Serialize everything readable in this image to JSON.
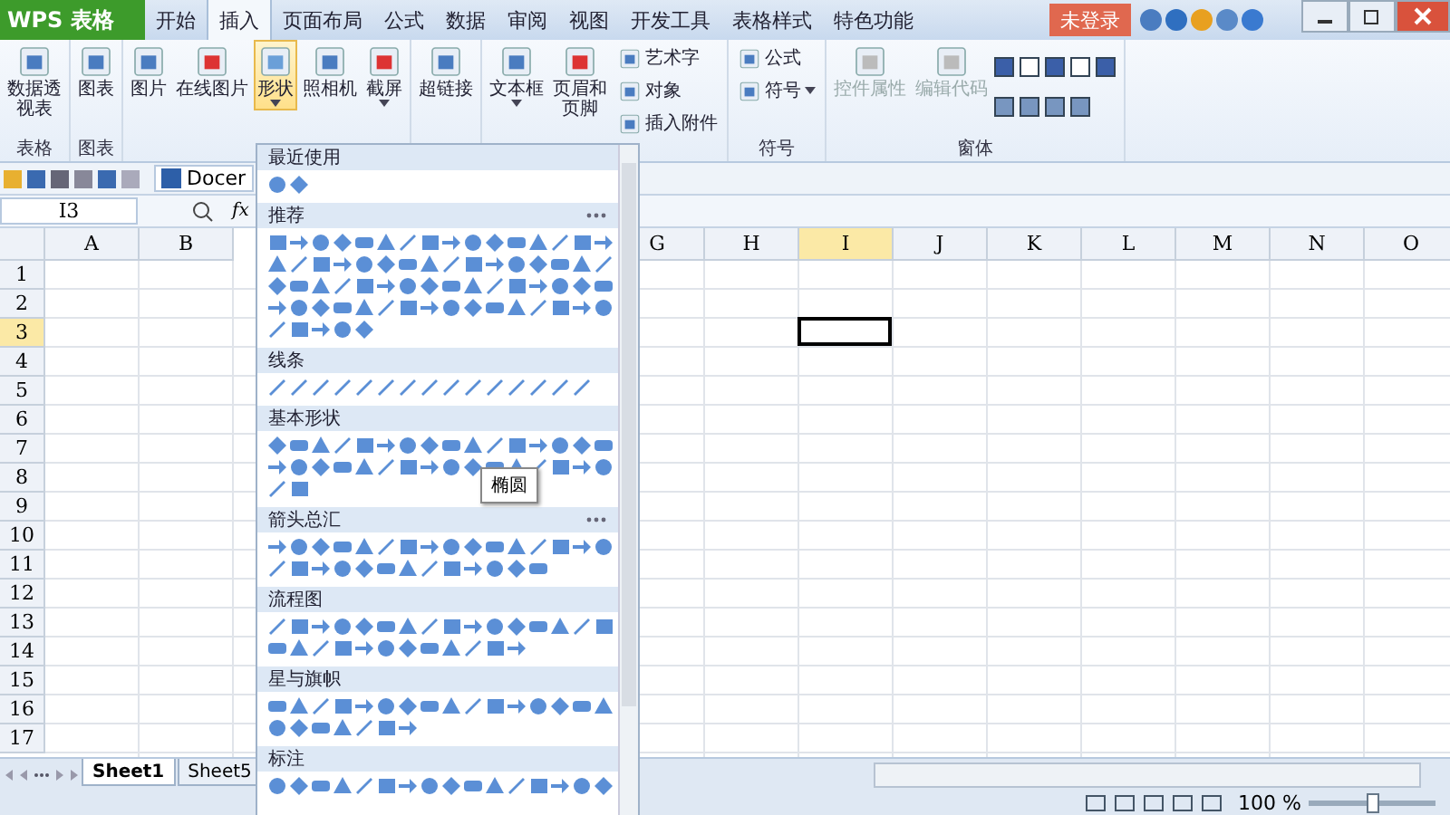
{
  "app_button": {
    "label": "WPS 表格"
  },
  "menu_tabs": [
    {
      "label": "开始",
      "selected": false
    },
    {
      "label": "插入",
      "selected": true
    },
    {
      "label": "页面布局",
      "selected": false
    },
    {
      "label": "公式",
      "selected": false
    },
    {
      "label": "数据",
      "selected": false
    },
    {
      "label": "审阅",
      "selected": false
    },
    {
      "label": "视图",
      "selected": false
    },
    {
      "label": "开发工具",
      "selected": false
    },
    {
      "label": "表格样式",
      "selected": false
    },
    {
      "label": "特色功能",
      "selected": false
    }
  ],
  "login": {
    "label": "未登录"
  },
  "ribbon": [
    {
      "label": "表格",
      "items": [
        {
          "kind": "large",
          "lines": [
            "数据透",
            "视表"
          ],
          "disabled": false,
          "selected": false,
          "dropdown": false
        }
      ]
    },
    {
      "label": "图表",
      "items": [
        {
          "kind": "large",
          "lines": [
            "图表"
          ],
          "disabled": false,
          "selected": false,
          "dropdown": false
        }
      ]
    },
    {
      "items": [
        {
          "kind": "large",
          "lines": [
            "图片"
          ],
          "disabled": false,
          "selected": false,
          "dropdown": false
        },
        {
          "kind": "large",
          "lines": [
            "在线图片"
          ],
          "disabled": false,
          "selected": false,
          "dropdown": false
        },
        {
          "kind": "large",
          "lines": [
            "形状"
          ],
          "disabled": false,
          "selected": true,
          "dropdown": true
        },
        {
          "kind": "large",
          "lines": [
            "照相机"
          ],
          "disabled": false,
          "selected": false,
          "dropdown": false
        },
        {
          "kind": "large",
          "lines": [
            "截屏"
          ],
          "disabled": false,
          "selected": false,
          "dropdown": true
        }
      ]
    },
    {
      "items": [
        {
          "kind": "large",
          "lines": [
            "超链接"
          ],
          "disabled": false,
          "selected": false,
          "dropdown": false
        }
      ]
    },
    {
      "items": [
        {
          "kind": "large",
          "lines": [
            "文本框"
          ],
          "disabled": false,
          "selected": false,
          "dropdown": true
        },
        {
          "kind": "large",
          "lines": [
            "页眉和",
            "页脚"
          ],
          "disabled": false,
          "selected": false,
          "dropdown": false
        },
        {
          "kind": "small",
          "lines": [
            "艺术字"
          ],
          "disabled": false,
          "selected": false,
          "dropdown": false
        },
        {
          "kind": "small",
          "lines": [
            "对象"
          ],
          "disabled": false,
          "selected": false,
          "dropdown": false
        },
        {
          "kind": "small",
          "lines": [
            "插入附件"
          ],
          "disabled": false,
          "selected": false,
          "dropdown": false
        }
      ]
    },
    {
      "label": "符号",
      "items": [
        {
          "kind": "small",
          "lines": [
            "公式"
          ],
          "disabled": false,
          "selected": false,
          "dropdown": false
        },
        {
          "kind": "small",
          "lines": [
            "符号"
          ],
          "disabled": false,
          "selected": false,
          "dropdown": true
        }
      ]
    },
    {
      "label": "窗体",
      "items": [
        {
          "kind": "large",
          "lines": [
            "控件属性"
          ],
          "disabled": true,
          "selected": false,
          "dropdown": false
        },
        {
          "kind": "large",
          "lines": [
            "编辑代码"
          ],
          "disabled": true,
          "selected": false,
          "dropdown": false
        },
        {
          "kind": "controls"
        }
      ]
    }
  ],
  "doc_tab": {
    "label": "Docer"
  },
  "name_box": {
    "value": "I3"
  },
  "fx_button": {
    "label": "fx"
  },
  "columns_left": [
    {
      "label": "A",
      "selected": false
    },
    {
      "label": "B",
      "selected": false
    }
  ],
  "columns_right": [
    {
      "label": "G",
      "selected": false
    },
    {
      "label": "H",
      "selected": false
    },
    {
      "label": "I",
      "selected": true
    },
    {
      "label": "J",
      "selected": false
    },
    {
      "label": "K",
      "selected": false
    },
    {
      "label": "L",
      "selected": false
    },
    {
      "label": "M",
      "selected": false
    },
    {
      "label": "N",
      "selected": false
    },
    {
      "label": "O",
      "selected": false
    }
  ],
  "rows": [
    {
      "label": "1",
      "selected": false
    },
    {
      "label": "2",
      "selected": false
    },
    {
      "label": "3",
      "selected": true
    },
    {
      "label": "4",
      "selected": false
    },
    {
      "label": "5",
      "selected": false
    },
    {
      "label": "6",
      "selected": false
    },
    {
      "label": "7",
      "selected": false
    },
    {
      "label": "8",
      "selected": false
    },
    {
      "label": "9",
      "selected": false
    },
    {
      "label": "10",
      "selected": false
    },
    {
      "label": "11",
      "selected": false
    },
    {
      "label": "12",
      "selected": false
    },
    {
      "label": "13",
      "selected": false
    },
    {
      "label": "14",
      "selected": false
    },
    {
      "label": "15",
      "selected": false
    },
    {
      "label": "16",
      "selected": false
    },
    {
      "label": "17",
      "selected": false
    }
  ],
  "sheet_tabs": [
    {
      "label": "Sheet1",
      "selected": true
    },
    {
      "label": "Sheet5",
      "selected": false
    }
  ],
  "zoom": {
    "label": "100 %",
    "level": 0.5
  },
  "shapes_panel": {
    "sections": [
      {
        "title": "最近使用",
        "more": false
      },
      {
        "title": "推荐",
        "more": true
      },
      {
        "title": "线条",
        "more": false
      },
      {
        "title": "基本形状",
        "more": false
      },
      {
        "title": "箭头总汇",
        "more": true
      },
      {
        "title": "流程图",
        "more": false
      },
      {
        "title": "星与旗帜",
        "more": false
      },
      {
        "title": "标注",
        "more": false
      }
    ],
    "tooltip": "椭圆"
  }
}
